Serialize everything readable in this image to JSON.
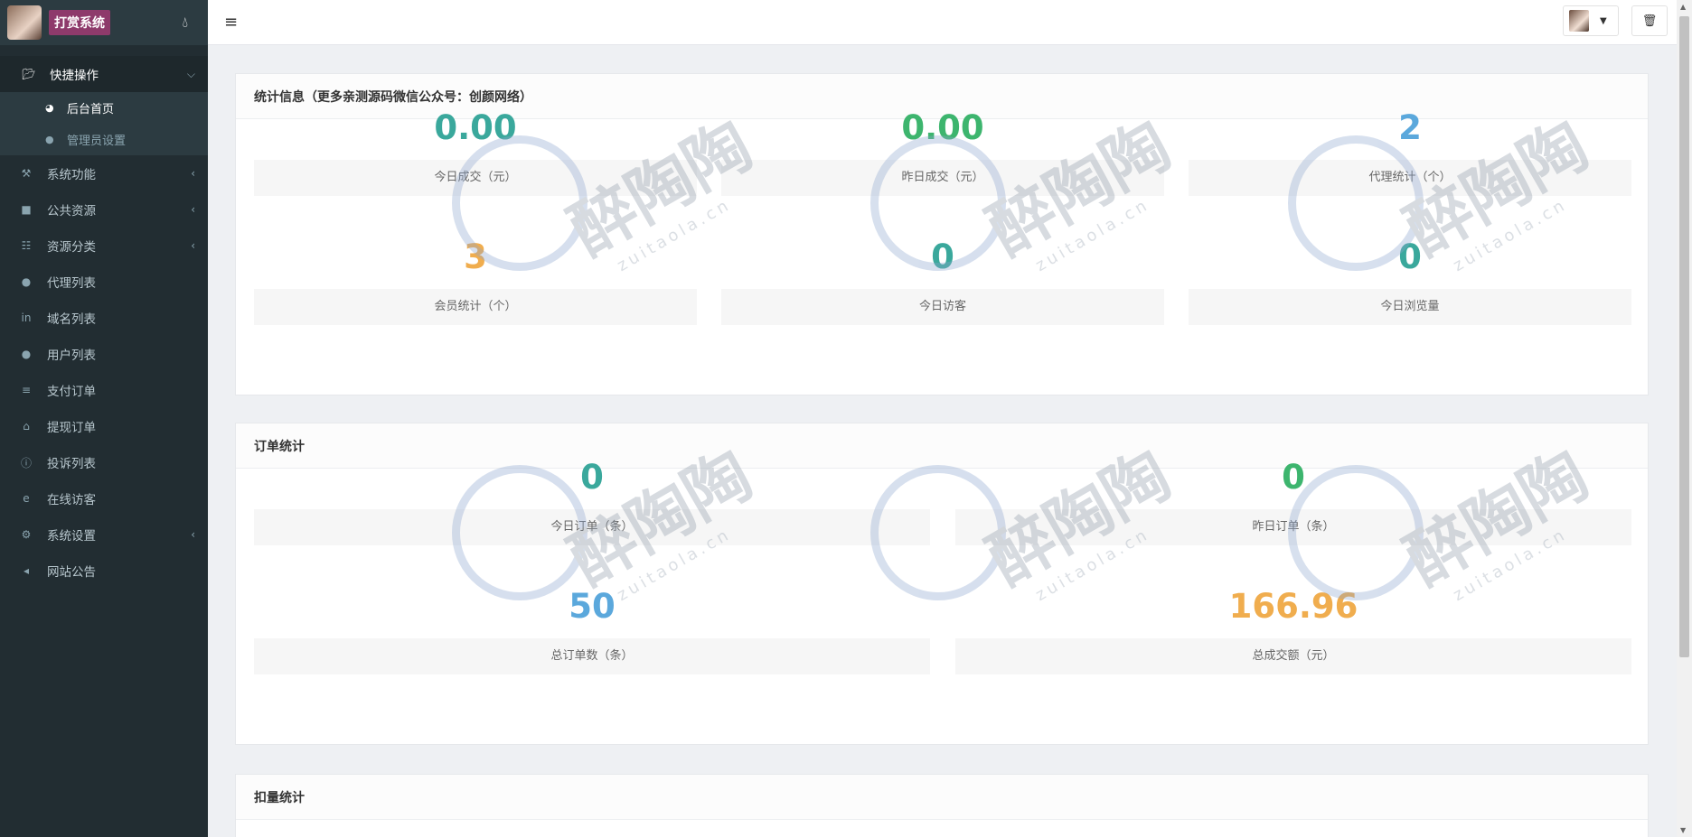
{
  "brand": {
    "title": "打赏系统",
    "drop_icon": "drop-icon"
  },
  "sidebar": {
    "items": [
      {
        "label": "快捷操作",
        "icon": "folder-open-icon",
        "expanded": true
      },
      {
        "label": "系统功能",
        "icon": "wrench-icon"
      },
      {
        "label": "公共资源",
        "icon": "video-icon"
      },
      {
        "label": "资源分类",
        "icon": "th-large-icon"
      },
      {
        "label": "代理列表",
        "icon": "users-icon"
      },
      {
        "label": "域名列表",
        "icon": "linkedin-icon"
      },
      {
        "label": "用户列表",
        "icon": "user-icon"
      },
      {
        "label": "支付订单",
        "icon": "list-icon"
      },
      {
        "label": "提现订单",
        "icon": "bank-icon"
      },
      {
        "label": "投诉列表",
        "icon": "exclamation-icon"
      },
      {
        "label": "在线访客",
        "icon": "ie-icon"
      },
      {
        "label": "系统设置",
        "icon": "gear-icon"
      },
      {
        "label": "网站公告",
        "icon": "bullhorn-icon"
      }
    ],
    "submenu": [
      {
        "label": "后台首页",
        "icon": "dashboard-icon"
      },
      {
        "label": "管理员设置",
        "icon": "user-icon"
      }
    ]
  },
  "header": {
    "menu_icon": "hamburger-icon",
    "trash_icon": "trash-icon"
  },
  "stats_panel": {
    "title": "统计信息（更多亲测源码微信公众号：创颜网络）",
    "items": [
      {
        "value": "0.00",
        "label": "今日成交（元）",
        "color": "#3aa89c"
      },
      {
        "value": "0.00",
        "label": "昨日成交（元）",
        "color": "#3db56e"
      },
      {
        "value": "2",
        "label": "代理统计（个）",
        "color": "#5ba8dc"
      },
      {
        "value": "3",
        "label": "会员统计（个）",
        "color": "#f0ad4e"
      },
      {
        "value": "0",
        "label": "今日访客",
        "color": "#3aa89c"
      },
      {
        "value": "0",
        "label": "今日浏览量",
        "color": "#3aa89c"
      }
    ]
  },
  "orders_panel": {
    "title": "订单统计",
    "items": [
      {
        "value": "0",
        "label": "今日订单（条）",
        "color": "#3aa89c"
      },
      {
        "value": "0",
        "label": "昨日订单（条）",
        "color": "#3db56e"
      },
      {
        "value": "50",
        "label": "总订单数（条）",
        "color": "#5ba8dc"
      },
      {
        "value": "166.96",
        "label": "总成交额（元）",
        "color": "#f0ad4e"
      }
    ]
  },
  "deduct_panel": {
    "title": "扣量统计"
  },
  "watermark": {
    "text": "醉陶陶",
    "url": "zuitaola.cn"
  }
}
